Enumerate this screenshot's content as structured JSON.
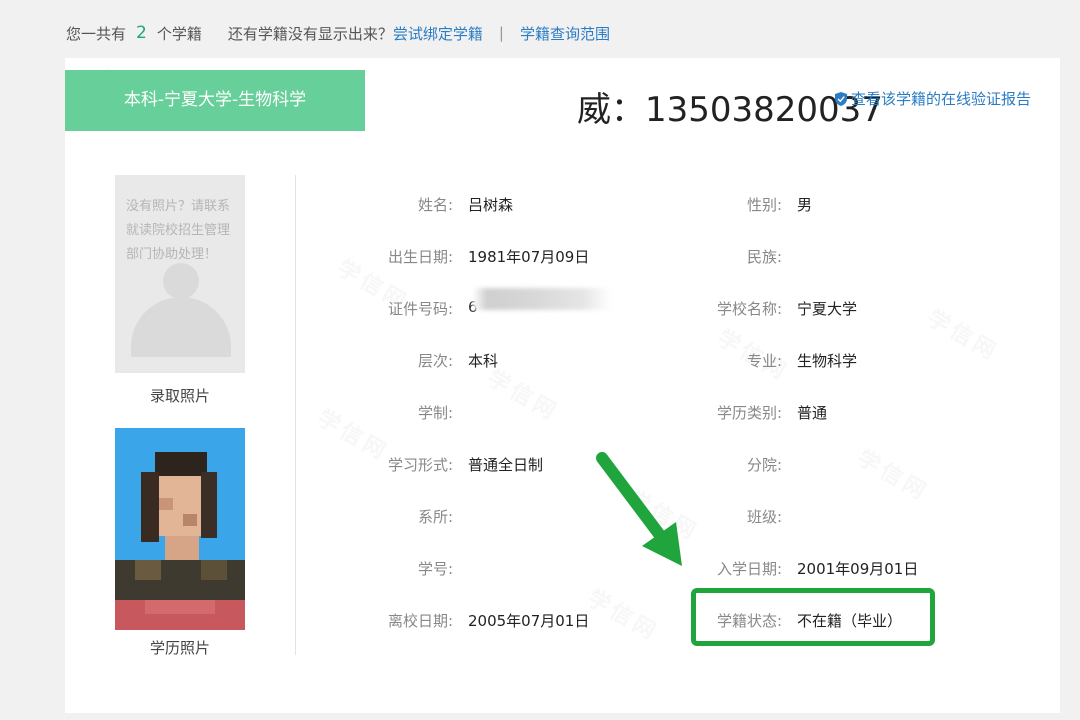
{
  "topbar": {
    "prefix": "您一共有",
    "count": "2",
    "suffix": "个学籍",
    "question": "还有学籍没有显示出来？",
    "bind_link": "尝试绑定学籍",
    "separator": "|",
    "scope_link": "学籍查询范围"
  },
  "record": {
    "tab_label": "本科-宁夏大学-生物科学",
    "phone_overlay": "威：13503820037",
    "verify_link": "查看该学籍的在线验证报告"
  },
  "photos": {
    "admission_hint": "没有照片？请联系就读院校招生管理部门协助处理！",
    "admission_caption": "录取照片",
    "education_caption": "学历照片"
  },
  "fields": {
    "name": {
      "label": "姓名:",
      "value": "吕树森"
    },
    "gender": {
      "label": "性别:",
      "value": "男"
    },
    "birth": {
      "label": "出生日期:",
      "value": "1981年07月09日"
    },
    "ethnicity": {
      "label": "民族:",
      "value": ""
    },
    "id_no": {
      "label": "证件号码:",
      "value": "6"
    },
    "school": {
      "label": "学校名称:",
      "value": "宁夏大学"
    },
    "level": {
      "label": "层次:",
      "value": "本科"
    },
    "major": {
      "label": "专业:",
      "value": "生物科学"
    },
    "duration": {
      "label": "学制:",
      "value": ""
    },
    "degree_type": {
      "label": "学历类别:",
      "value": "普通"
    },
    "study_form": {
      "label": "学习形式:",
      "value": "普通全日制"
    },
    "branch": {
      "label": "分院:",
      "value": ""
    },
    "department": {
      "label": "系所:",
      "value": ""
    },
    "class": {
      "label": "班级:",
      "value": ""
    },
    "student_no": {
      "label": "学号:",
      "value": ""
    },
    "enroll_date": {
      "label": "入学日期:",
      "value": "2001年09月01日"
    },
    "leave_date": {
      "label": "离校日期:",
      "value": "2005年07月01日"
    },
    "status": {
      "label": "学籍状态:",
      "value": "不在籍（毕业）"
    }
  },
  "watermark_text": "学信网",
  "colors": {
    "accent_green": "#67cf99",
    "link_blue": "#2a7cc4",
    "highlight_green": "#1fa53c"
  }
}
